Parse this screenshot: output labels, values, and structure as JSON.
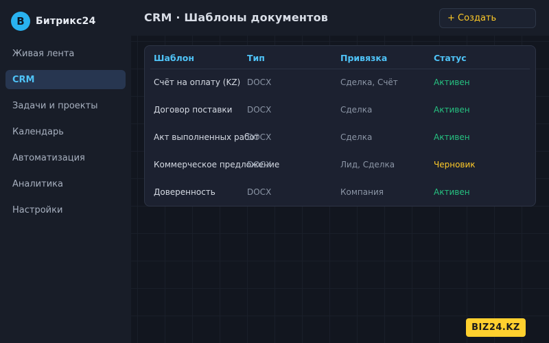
{
  "brand": {
    "logo_letter": "B",
    "name": "Битрикс24"
  },
  "sidebar": {
    "items": [
      {
        "label": "Живая лента",
        "active": false
      },
      {
        "label": "CRM",
        "active": true
      },
      {
        "label": "Задачи и проекты",
        "active": false
      },
      {
        "label": "Календарь",
        "active": false
      },
      {
        "label": "Автоматизация",
        "active": false
      },
      {
        "label": "Аналитика",
        "active": false
      },
      {
        "label": "Настройки",
        "active": false
      }
    ]
  },
  "header": {
    "title": "CRM · Шаблоны документов",
    "create_label": "+ Создать"
  },
  "table": {
    "columns": [
      "Шаблон",
      "Тип",
      "Привязка",
      "Статус"
    ],
    "rows": [
      {
        "name": "Счёт на оплату (KZ)",
        "type": "DOCX",
        "binding": "Сделка, Счёт",
        "status": "Активен",
        "status_kind": "active"
      },
      {
        "name": "Договор поставки",
        "type": "DOCX",
        "binding": "Сделка",
        "status": "Активен",
        "status_kind": "active"
      },
      {
        "name": "Акт выполненных работ",
        "type": "DOCX",
        "binding": "Сделка",
        "status": "Активен",
        "status_kind": "active"
      },
      {
        "name": "Коммерческое предложение",
        "type": "DOCX",
        "binding": "Лид, Сделка",
        "status": "Черновик",
        "status_kind": "draft"
      },
      {
        "name": "Доверенность",
        "type": "DOCX",
        "binding": "Компания",
        "status": "Активен",
        "status_kind": "active"
      }
    ]
  },
  "watermark": {
    "label": "BIZ24.KZ"
  },
  "colors": {
    "accent": "#4fc3f7",
    "active_status": "#26c281",
    "draft_status": "#ffca28",
    "badge": "#ffd02e"
  }
}
